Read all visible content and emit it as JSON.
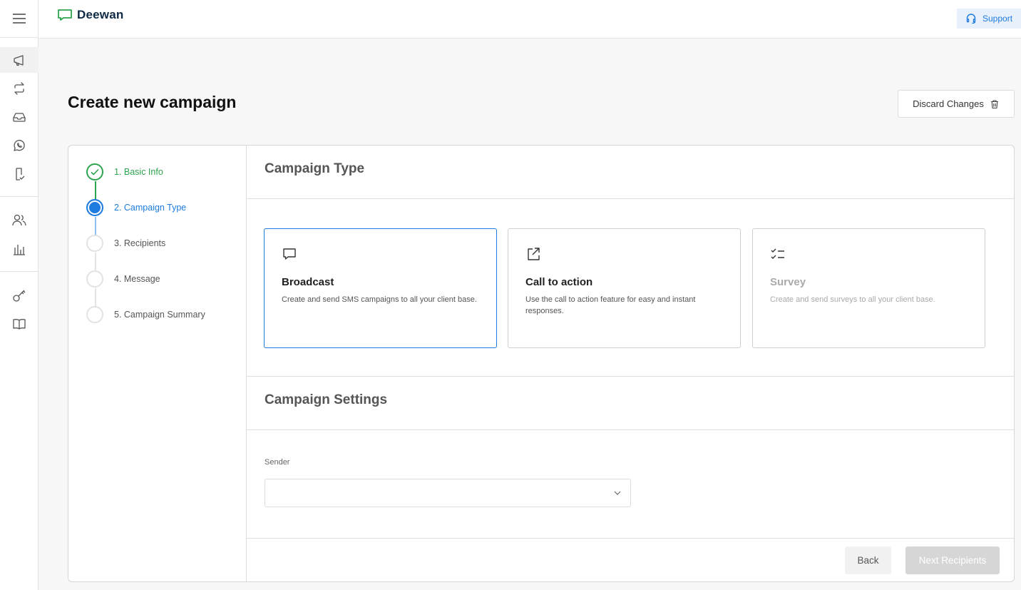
{
  "app": {
    "brand": "Deewan",
    "support_label": "Support"
  },
  "page": {
    "title": "Create new campaign",
    "discard_label": "Discard Changes"
  },
  "steps": [
    {
      "label": "1. Basic Info",
      "state": "done"
    },
    {
      "label": "2. Campaign Type",
      "state": "current"
    },
    {
      "label": "3. Recipients",
      "state": "pending"
    },
    {
      "label": "4. Message",
      "state": "pending"
    },
    {
      "label": "5. Campaign Summary",
      "state": "pending"
    }
  ],
  "campaign_type": {
    "title": "Campaign Type",
    "options": [
      {
        "name": "Broadcast",
        "desc": "Create and send SMS campaigns to all your client base.",
        "icon": "message-square-icon",
        "state": "selected"
      },
      {
        "name": "Call to action",
        "desc": "Use the call to action feature for easy and instant responses.",
        "icon": "external-link-icon",
        "state": "normal"
      },
      {
        "name": "Survey",
        "desc": "Create and send surveys to all your client base.",
        "icon": "checklist-icon",
        "state": "disabled"
      }
    ]
  },
  "campaign_settings": {
    "title": "Campaign Settings",
    "sender_label": "Sender",
    "sender_value": ""
  },
  "footer": {
    "back_label": "Back",
    "next_label": "Next Recipients"
  },
  "colors": {
    "accent": "#1e7be0",
    "success": "#2ea44f",
    "brand_dark": "#0f2a44"
  }
}
